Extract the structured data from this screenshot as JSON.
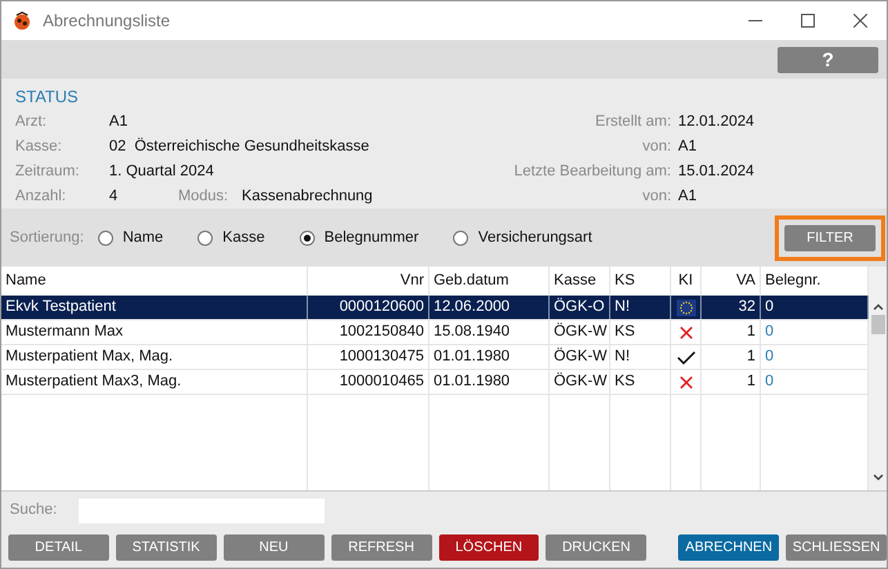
{
  "window": {
    "title": "Abrechnungsliste"
  },
  "help_button": "?",
  "status": {
    "heading": "STATUS",
    "left": [
      {
        "label": "Arzt:",
        "value": "A1"
      },
      {
        "label": "Kasse:",
        "value": "02  Österreichische Gesundheitskasse"
      },
      {
        "label": "Zeitraum:",
        "value": "1. Quartal 2024"
      }
    ],
    "anzahl": {
      "label": "Anzahl:",
      "value": "4"
    },
    "modus": {
      "label": "Modus:",
      "value": "Kassenabrechnung"
    },
    "right": [
      {
        "label": "Erstellt am:",
        "value": "12.01.2024"
      },
      {
        "label": "von:",
        "value": "A1"
      },
      {
        "label": "Letzte Bearbeitung am:",
        "value": "15.01.2024"
      },
      {
        "label": "von:",
        "value": "A1"
      }
    ]
  },
  "sort": {
    "label": "Sortierung:",
    "options": [
      {
        "label": "Name",
        "selected": false
      },
      {
        "label": "Kasse",
        "selected": false
      },
      {
        "label": "Belegnummer",
        "selected": true
      },
      {
        "label": "Versicherungsart",
        "selected": false
      }
    ]
  },
  "filter_button": {
    "label": "FILTER",
    "focused": true
  },
  "table": {
    "columns": [
      "Name",
      "Vnr",
      "Geb.datum",
      "Kasse",
      "KS",
      "KI",
      "VA",
      "Belegnr."
    ],
    "rows": [
      {
        "selected": true,
        "name": "Ekvk Testpatient",
        "vnr": "0000120600",
        "geb": "12.06.2000",
        "kasse": "ÖGK-O",
        "ks": "N!",
        "ki": {
          "kind": "eu"
        },
        "va": "32",
        "belegnr": "0"
      },
      {
        "selected": false,
        "name": "Mustermann Max",
        "vnr": "1002150840",
        "geb": "15.08.1940",
        "kasse": "ÖGK-W",
        "ks": "KS",
        "ki": {
          "kind": "cross"
        },
        "va": "1",
        "belegnr": "0"
      },
      {
        "selected": false,
        "name": "Musterpatient Max, Mag.",
        "vnr": "1000130475",
        "geb": "01.01.1980",
        "kasse": "ÖGK-W",
        "ks": "N!",
        "ki": {
          "kind": "check"
        },
        "va": "1",
        "belegnr": "0"
      },
      {
        "selected": false,
        "name": "Musterpatient Max3, Mag.",
        "vnr": "1000010465",
        "geb": "01.01.1980",
        "kasse": "ÖGK-W",
        "ks": "KS",
        "ki": {
          "kind": "cross"
        },
        "va": "1",
        "belegnr": "0"
      }
    ]
  },
  "search": {
    "label": "Suche:"
  },
  "buttons": [
    {
      "label": "DETAIL",
      "kind": "normal"
    },
    {
      "label": "STATISTIK",
      "kind": "normal"
    },
    {
      "label": "NEU",
      "kind": "normal"
    },
    {
      "label": "REFRESH",
      "kind": "normal"
    },
    {
      "label": "LÖSCHEN",
      "kind": "danger"
    },
    {
      "label": "DRUCKEN",
      "kind": "normal"
    },
    {
      "label": "ABRECHNEN",
      "kind": "primary"
    },
    {
      "label": "SCHLIESSEN",
      "kind": "normal"
    }
  ]
}
